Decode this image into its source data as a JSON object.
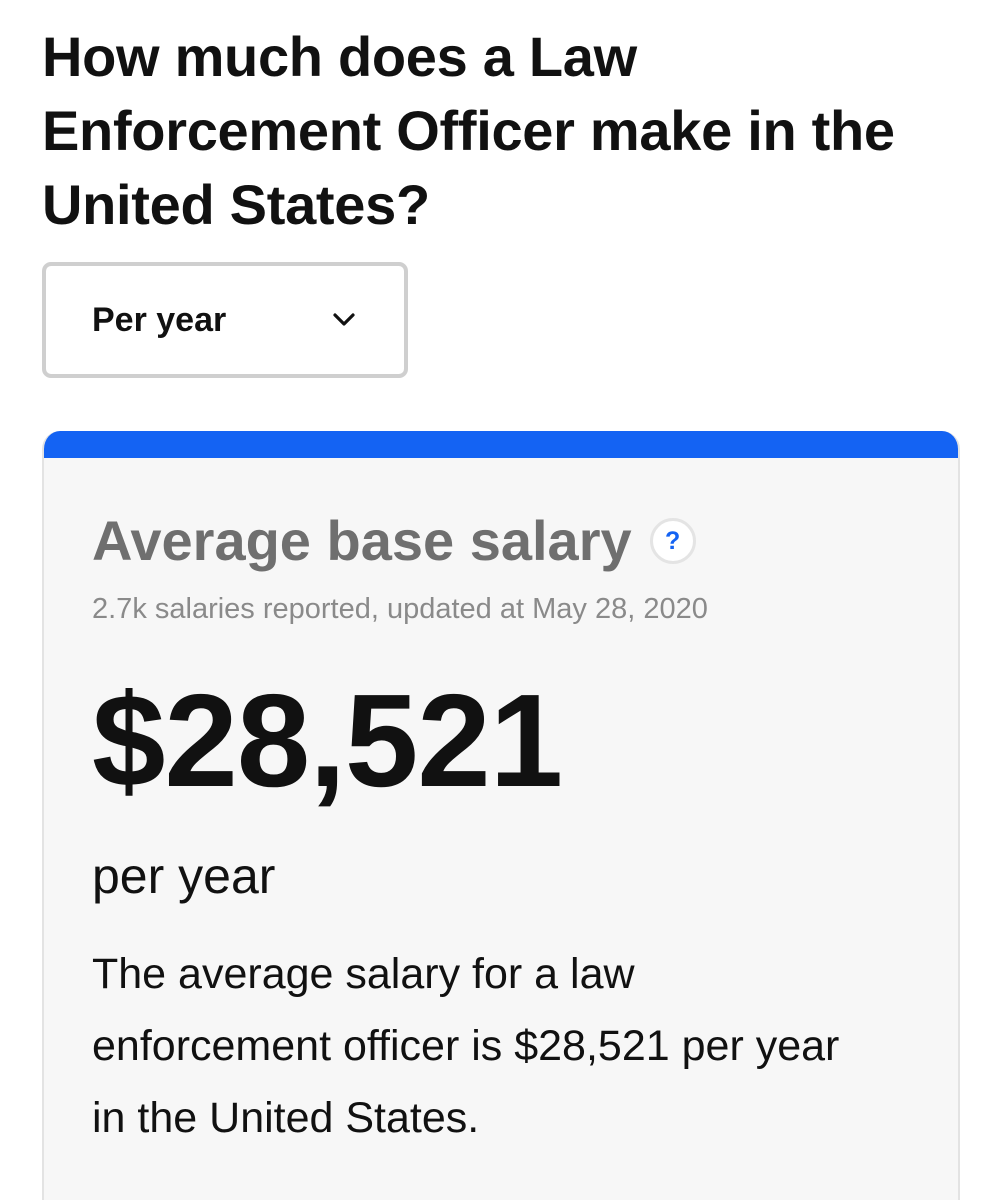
{
  "header": {
    "title": "How much does a Law Enforcement Officer make in the United States?"
  },
  "period_select": {
    "selected": "Per year",
    "icon": "chevron-down-icon"
  },
  "salary_card": {
    "accent_color": "#1463f3",
    "heading": "Average base salary",
    "help_icon": "?",
    "meta": "2.7k salaries reported, updated at May 28, 2020",
    "amount": "$28,521",
    "period": "per year",
    "description": "The average salary for a law enforcement officer is $28,521 per year in the United States."
  }
}
